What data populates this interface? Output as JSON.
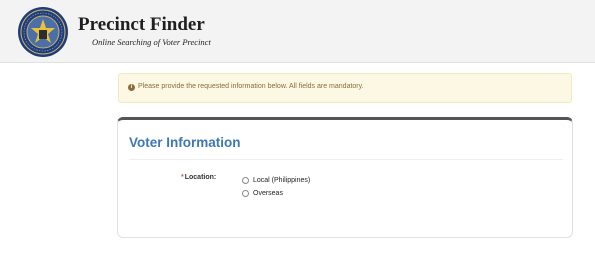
{
  "header": {
    "title": "Precinct Finder",
    "subtitle": "Online Searching of Voter Precinct"
  },
  "alert": {
    "icon": "info-circle-icon",
    "text": "Please provide the requested information below. All fields are mandatory."
  },
  "panel": {
    "title": "Voter Information",
    "location": {
      "required_mark": "*",
      "label": "Location:",
      "options": [
        {
          "label": "Local (Philippines)",
          "selected": false
        },
        {
          "label": "Overseas",
          "selected": false
        }
      ]
    }
  },
  "colors": {
    "header_bg": "#f3f3f3",
    "alert_bg": "#fcf8e3",
    "alert_text": "#8a6d3b",
    "panel_title": "#3d78b4",
    "required": "#d9534f"
  }
}
